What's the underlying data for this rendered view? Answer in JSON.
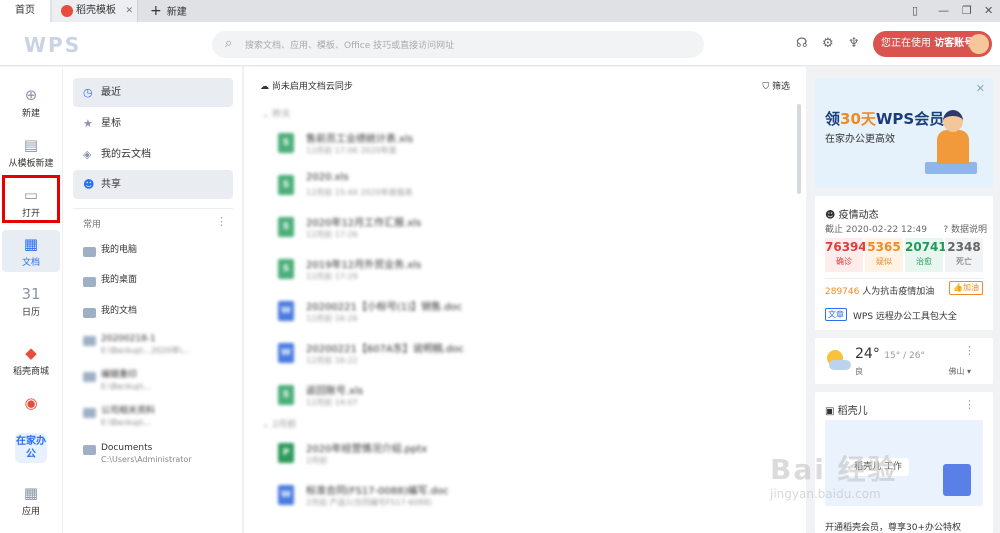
{
  "tabs": {
    "home": "首页",
    "docer": "稻壳模板",
    "new_tab": "新建"
  },
  "header": {
    "logo": "WPS",
    "search_placeholder": "搜索文档、应用、模板、Office 技巧或直接访问网址",
    "visitor_prefix": "您正在使用",
    "visitor_label": "访客账号"
  },
  "left_nav": {
    "new": "新建",
    "from_template": "从模板新建",
    "open": "打开",
    "docs": "文档",
    "calendar": "日历",
    "calendar_icon": "31",
    "mall": "稻壳商城",
    "work_home": "在家办公",
    "apps": "应用"
  },
  "sidebar": {
    "recent": "最近",
    "star": "星标",
    "cloud": "我的云文档",
    "shared": "共享",
    "common_heading": "常用",
    "locations": [
      {
        "title": "我的电脑",
        "path": ""
      },
      {
        "title": "我的桌面",
        "path": ""
      },
      {
        "title": "我的文档",
        "path": ""
      },
      {
        "title": "20200218-1",
        "path": "E:\\Backup\\...2020年\\..."
      },
      {
        "title": "编辑重印",
        "path": "E:\\Backup\\..."
      },
      {
        "title": "公司相关资料",
        "path": "E:\\Backup\\..."
      },
      {
        "title": "Documents",
        "path": "C:\\Users\\Administrator"
      }
    ]
  },
  "main": {
    "cloud_sync": "尚未启用文档云同步",
    "filter": "筛选",
    "group_yesterday": "昨天",
    "group_earlier": "2月前",
    "files": [
      {
        "name": "售前员工业绩统计表.xls",
        "meta": "12月前 17:06   2020年度",
        "type": "S"
      },
      {
        "name": "2020.xls",
        "meta": "12月前 15:44   2020年度报表",
        "type": "S"
      },
      {
        "name": "2020年12月工作汇报.xls",
        "meta": "12月前 17:26",
        "type": "S"
      },
      {
        "name": "2019年12月外贸业务.xls",
        "meta": "12月前 17:29",
        "type": "S"
      },
      {
        "name": "20200221【小标号(1)】销售.doc",
        "meta": "12月前 16:26",
        "type": "W"
      },
      {
        "name": "20200221【607A东】说明稿.doc",
        "meta": "12月前 16:22",
        "type": "W"
      },
      {
        "name": "返回账号.xls",
        "meta": "12月前 14:07",
        "type": "S"
      },
      {
        "name": "2020年经营情况介绍.pptx",
        "meta": "2月前",
        "type": "P"
      },
      {
        "name": "标准合同(FS17-0088)编写.doc",
        "meta": "2月前   产品1(合同编号FS17-6088)",
        "type": "W"
      }
    ]
  },
  "promo": {
    "prefix": "领",
    "highlight": "30天",
    "suffix": "WPS会员",
    "subtitle": "在家办公更高效"
  },
  "epidemic": {
    "title": "疫情动态",
    "date": "截止 2020-02-22 12:49",
    "explain": "数据说明",
    "stats": [
      {
        "num": "76394",
        "label": "确诊",
        "color": "#e23c3c",
        "bg": "#fdecec"
      },
      {
        "num": "5365",
        "label": "疑似",
        "color": "#f08a24",
        "bg": "#fff3e6"
      },
      {
        "num": "20741",
        "label": "治愈",
        "color": "#1e9b5a",
        "bg": "#e7f6ee"
      },
      {
        "num": "2348",
        "label": "死亡",
        "color": "#666666",
        "bg": "#f2f3f5"
      }
    ],
    "cheer_num": "289746",
    "cheer_text": " 人为抗击疫情加油",
    "cheer_button": "加油",
    "article_tag": "文章",
    "article": "WPS 远程办公工具包大全"
  },
  "weather": {
    "temp": "24°",
    "range": "15° / 26°",
    "quality": "良",
    "city": "佛山"
  },
  "docer": {
    "title": "稻壳儿",
    "foot": "开通稻壳会员，尊享30+办公特权",
    "banner": "稻壳儿 工作"
  },
  "watermark": {
    "main": "Bai 经验",
    "sub": "jingyan.baidu.com"
  }
}
